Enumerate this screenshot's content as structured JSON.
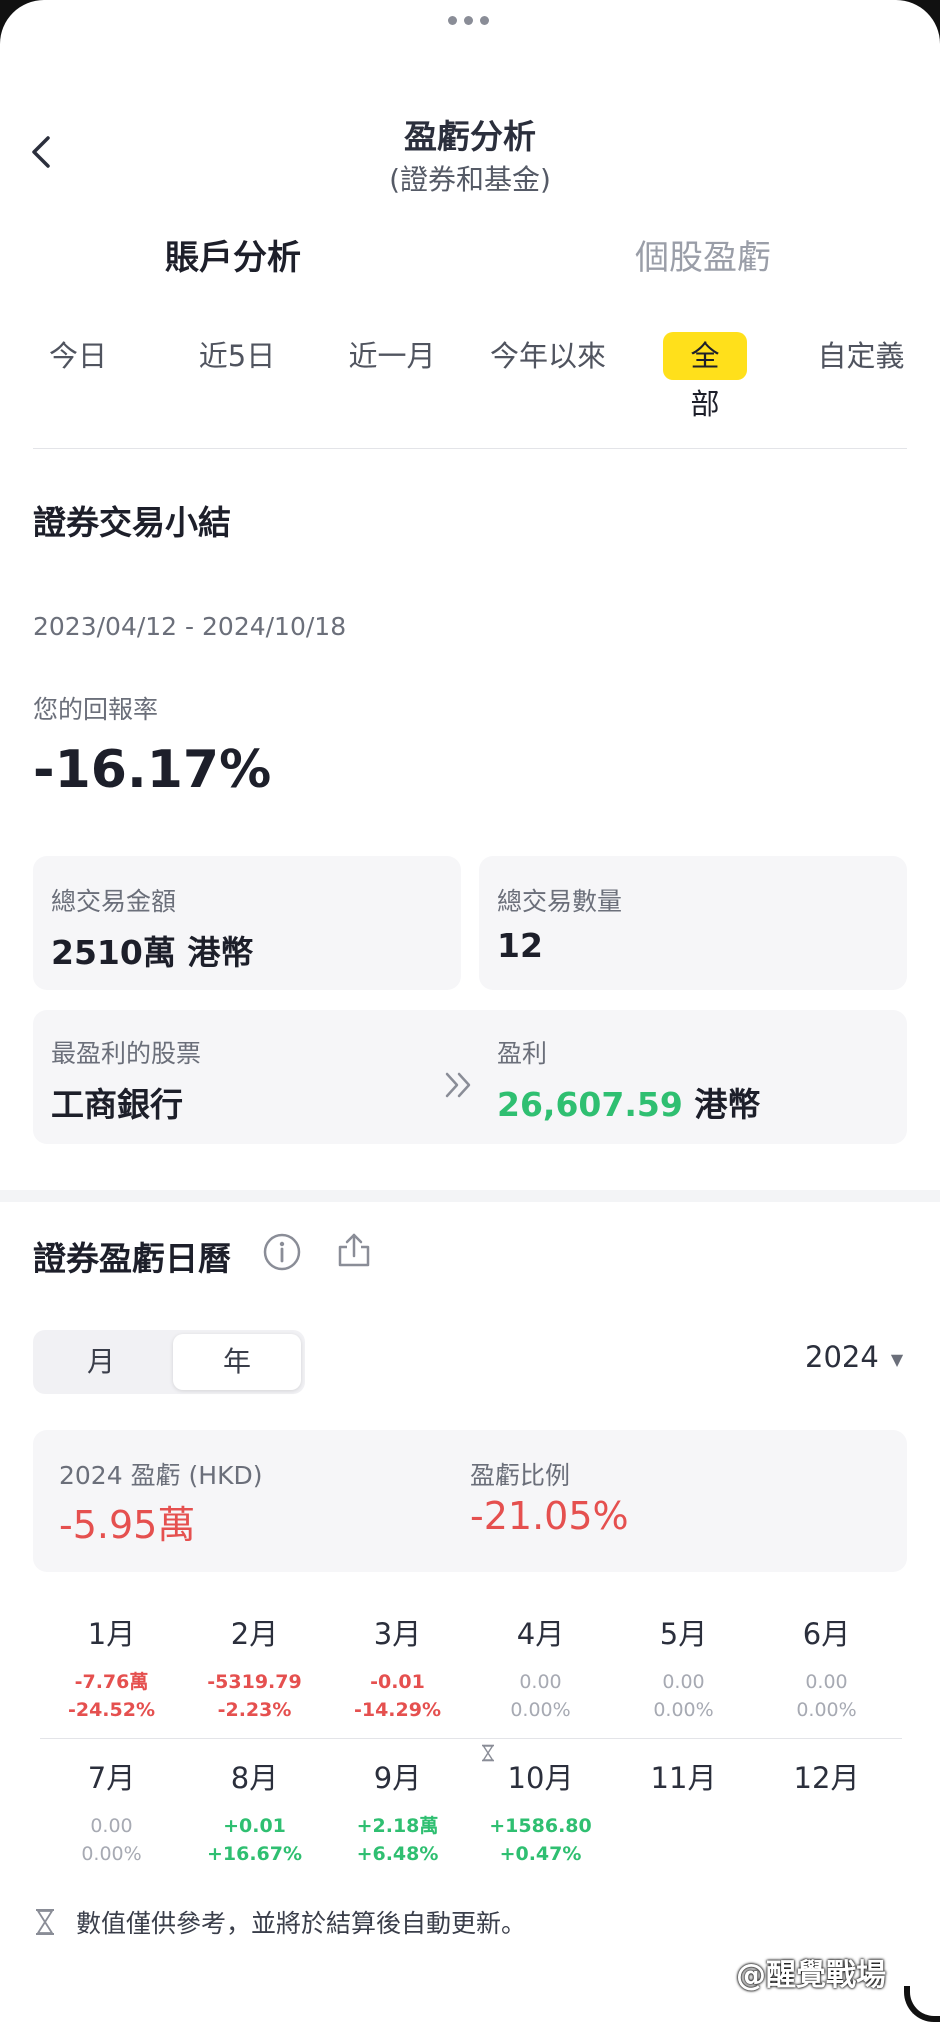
{
  "header": {
    "title": "盈虧分析",
    "subtitle": "(證券和基金)"
  },
  "main_tabs": [
    {
      "label": "賬戶分析",
      "active": true
    },
    {
      "label": "個股盈虧",
      "active": false
    }
  ],
  "periods": [
    {
      "label": "今日",
      "selected": false
    },
    {
      "label": "近5日",
      "selected": false
    },
    {
      "label": "近一月",
      "selected": false
    },
    {
      "label": "今年以來",
      "selected": false
    },
    {
      "label": "全部",
      "selected": true
    },
    {
      "label": "自定義",
      "selected": false
    }
  ],
  "summary_section": {
    "title": "證券交易小結",
    "date_range": "2023/04/12 - 2024/10/18",
    "return_label": "您的回報率",
    "return_value": "-16.17%",
    "total_amount": {
      "label": "總交易金額",
      "value": "2510萬 港幣"
    },
    "total_count": {
      "label": "總交易數量",
      "value": "12"
    },
    "top_stock": {
      "label": "最盈利的股票",
      "value": "工商銀行"
    },
    "profit": {
      "label": "盈利",
      "value": "26,607.59",
      "currency": "港幣"
    }
  },
  "calendar": {
    "title": "證券盈虧日曆",
    "segments": [
      {
        "label": "月",
        "selected": false
      },
      {
        "label": "年",
        "selected": true
      }
    ],
    "year": "2024",
    "pl_label": "2024 盈虧 (HKD)",
    "pl_value": "-5.95萬",
    "ratio_label": "盈虧比例",
    "ratio_value": "-21.05%",
    "months": [
      {
        "name": "1月",
        "value": "-7.76萬",
        "pct": "-24.52%",
        "tone": "red"
      },
      {
        "name": "2月",
        "value": "-5319.79",
        "pct": "-2.23%",
        "tone": "red"
      },
      {
        "name": "3月",
        "value": "-0.01",
        "pct": "-14.29%",
        "tone": "red"
      },
      {
        "name": "4月",
        "value": "0.00",
        "pct": "0.00%",
        "tone": "grey"
      },
      {
        "name": "5月",
        "value": "0.00",
        "pct": "0.00%",
        "tone": "grey"
      },
      {
        "name": "6月",
        "value": "0.00",
        "pct": "0.00%",
        "tone": "grey"
      },
      {
        "name": "7月",
        "value": "0.00",
        "pct": "0.00%",
        "tone": "grey"
      },
      {
        "name": "8月",
        "value": "+0.01",
        "pct": "+16.67%",
        "tone": "green"
      },
      {
        "name": "9月",
        "value": "+2.18萬",
        "pct": "+6.48%",
        "tone": "green"
      },
      {
        "name": "10月",
        "value": "+1586.80",
        "pct": "+0.47%",
        "tone": "green"
      },
      {
        "name": "11月",
        "value": "",
        "pct": "",
        "tone": "none"
      },
      {
        "name": "12月",
        "value": "",
        "pct": "",
        "tone": "none"
      }
    ],
    "footnote": "數值僅供參考，並將於結算後自動更新。"
  },
  "watermark": "@醒覺戰場",
  "colors": {
    "accent_yellow": "#ffe01b",
    "loss_red": "#e5504f",
    "gain_green": "#2fbf71",
    "card_bg": "#f6f6f8"
  }
}
